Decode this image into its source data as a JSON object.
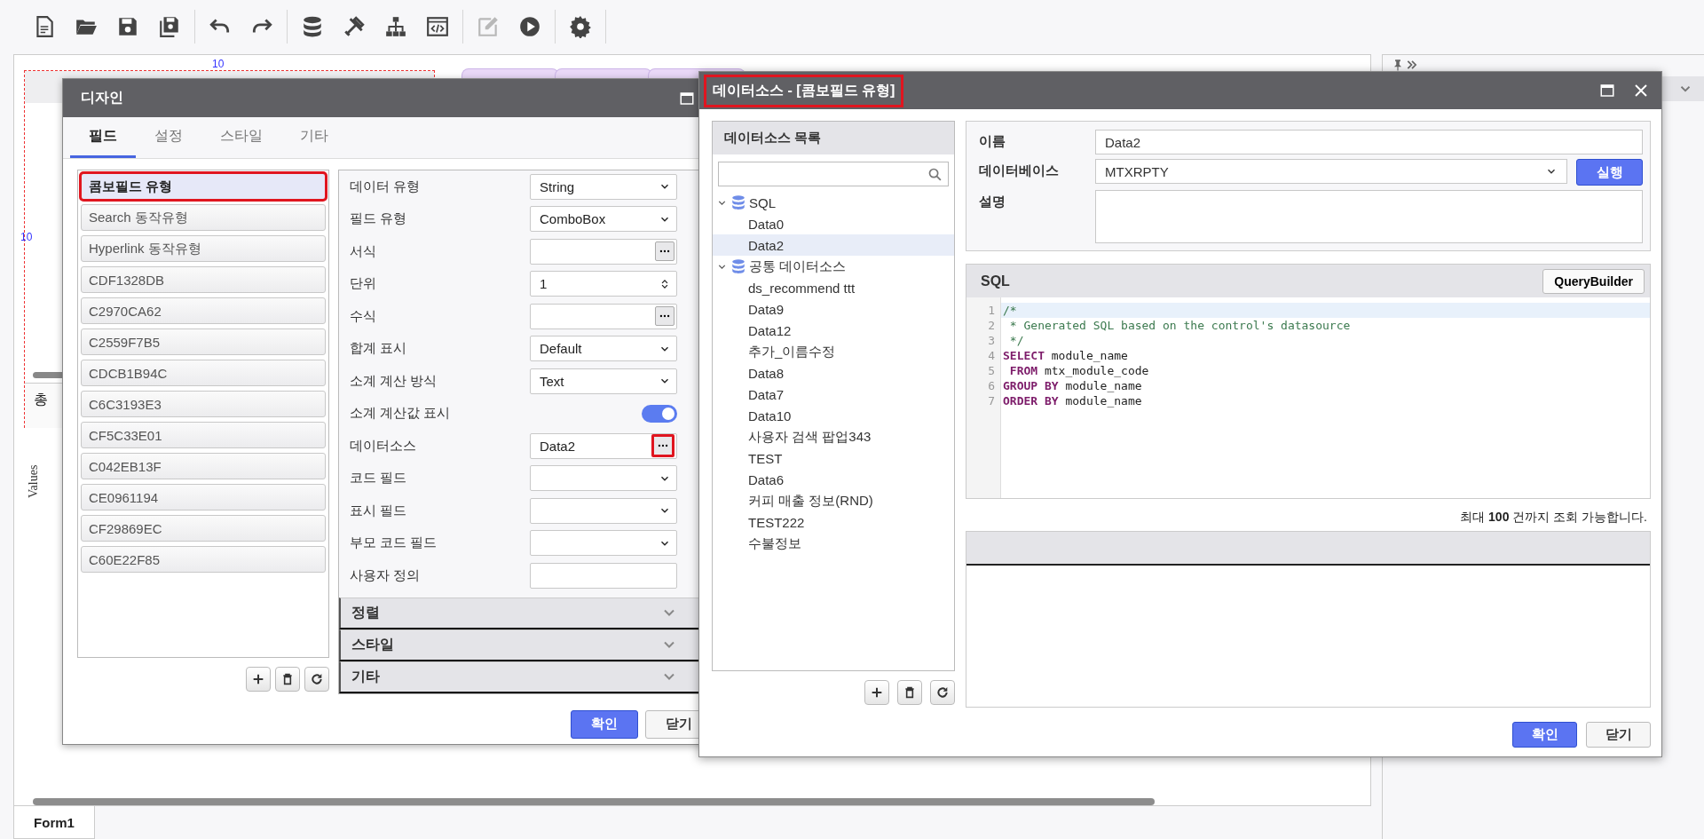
{
  "toolbar": {
    "groups": [
      [
        {
          "disabled": false
        },
        {
          "disabled": false
        },
        {
          "disabled": false
        },
        {
          "disabled": false
        }
      ],
      [
        {
          "disabled": false
        },
        {
          "disabled": false
        }
      ],
      [
        {
          "disabled": false
        },
        {
          "disabled": false
        },
        {
          "disabled": false
        },
        {
          "disabled": false
        }
      ],
      [
        {
          "disabled": true
        },
        {
          "disabled": false
        }
      ],
      [
        {
          "disabled": false
        }
      ]
    ]
  },
  "canvas": {
    "ruler_labels": [
      "10",
      "10"
    ],
    "summary_label": "총",
    "axis_label": "Values"
  },
  "form_tabs": [
    {
      "label": "Form1",
      "selected": true
    }
  ],
  "design_dialog": {
    "title": "디자인",
    "tabs": [
      {
        "label": "필드",
        "selected": true
      },
      {
        "label": "설정",
        "selected": false
      },
      {
        "label": "스타일",
        "selected": false
      },
      {
        "label": "기타",
        "selected": false
      }
    ],
    "fields": [
      {
        "label": "콤보필드 유형",
        "selected": true,
        "highlighted": true
      },
      {
        "label": "Search 동작유형",
        "selected": false,
        "highlighted": false
      },
      {
        "label": "Hyperlink 동작유형",
        "selected": false,
        "highlighted": false
      },
      {
        "label": "CDF1328DB",
        "selected": false,
        "highlighted": false
      },
      {
        "label": "C2970CA62",
        "selected": false,
        "highlighted": false
      },
      {
        "label": "C2559F7B5",
        "selected": false,
        "highlighted": false
      },
      {
        "label": "CDCB1B94C",
        "selected": false,
        "highlighted": false
      },
      {
        "label": "C6C3193E3",
        "selected": false,
        "highlighted": false
      },
      {
        "label": "CF5C33E01",
        "selected": false,
        "highlighted": false
      },
      {
        "label": "C042EB13F",
        "selected": false,
        "highlighted": false
      },
      {
        "label": "CE0961194",
        "selected": false,
        "highlighted": false
      },
      {
        "label": "CF29869EC",
        "selected": false,
        "highlighted": false
      },
      {
        "label": "C60E22F85",
        "selected": false,
        "highlighted": false
      }
    ],
    "properties": [
      {
        "label": "데이터 유형",
        "kind": "select",
        "value": "String"
      },
      {
        "label": "필드 유형",
        "kind": "select",
        "value": "ComboBox"
      },
      {
        "label": "서식",
        "kind": "picker",
        "highlighted": false
      },
      {
        "label": "단위",
        "kind": "spinner",
        "value": "1"
      },
      {
        "label": "수식",
        "kind": "picker",
        "highlighted": false
      },
      {
        "label": "합계 표시",
        "kind": "select",
        "value": "Default"
      },
      {
        "label": "소계 계산 방식",
        "kind": "select",
        "value": "Text"
      },
      {
        "label": "소계 계산값 표시",
        "kind": "toggle",
        "on": true
      },
      {
        "label": "데이터소스",
        "kind": "picker",
        "value": "Data2",
        "highlighted": true
      },
      {
        "label": "코드 필드",
        "kind": "select"
      },
      {
        "label": "표시 필드",
        "kind": "select"
      },
      {
        "label": "부모 코드 필드",
        "kind": "select"
      },
      {
        "label": "사용자 정의",
        "kind": "text"
      }
    ],
    "sections": [
      "정렬",
      "스타일",
      "기타"
    ],
    "buttons": [
      "확인",
      "닫기"
    ]
  },
  "datasource_dialog": {
    "title": "데이터소스 - [콤보필드 유형]",
    "title_highlighted": true,
    "list_title": "데이터소스 목록",
    "tree": [
      {
        "label": "SQL",
        "expanded": true,
        "selected": false,
        "children": [
          {
            "label": "Data0",
            "selected": false
          },
          {
            "label": "Data2",
            "selected": true
          }
        ]
      },
      {
        "label": "공통 데이터소스",
        "expanded": true,
        "selected": false,
        "children": [
          {
            "label": "ds_recommend ttt",
            "selected": false
          },
          {
            "label": "Data9",
            "selected": false
          },
          {
            "label": "Data12",
            "selected": false
          },
          {
            "label": "추가_이름수정",
            "selected": false
          },
          {
            "label": "Data8",
            "selected": false
          },
          {
            "label": "Data7",
            "selected": false
          },
          {
            "label": "Data10",
            "selected": false
          },
          {
            "label": "사용자 검색 팝업343",
            "selected": false
          },
          {
            "label": "TEST",
            "selected": false
          },
          {
            "label": "Data6",
            "selected": false
          },
          {
            "label": "커피 매출 정보(RND)",
            "selected": false
          },
          {
            "label": "TEST222",
            "selected": false
          },
          {
            "label": "수불정보",
            "selected": false
          }
        ]
      }
    ],
    "name_label": "이름",
    "name_value": "Data2",
    "database_label": "데이터베이스",
    "database_value": "MTXRPTY",
    "run_button": "실행",
    "description_label": "설명",
    "sql_title": "SQL",
    "query_builder_button": "QueryBuilder",
    "code_lines": [
      {
        "number": "1",
        "current": true,
        "tokens": [
          {
            "kind": "comment",
            "text": "/*"
          }
        ]
      },
      {
        "number": "2",
        "current": false,
        "tokens": [
          {
            "kind": "comment",
            "text": " * Generated SQL based on the control's datasource"
          }
        ]
      },
      {
        "number": "3",
        "current": false,
        "tokens": [
          {
            "kind": "comment",
            "text": " */"
          }
        ]
      },
      {
        "number": "4",
        "current": false,
        "tokens": [
          {
            "kind": "keyword",
            "text": "SELECT"
          },
          {
            "kind": "plain",
            "text": " module_name"
          }
        ]
      },
      {
        "number": "5",
        "current": false,
        "tokens": [
          {
            "kind": "keyword",
            "text": " FROM"
          },
          {
            "kind": "plain",
            "text": " mtx_module_code"
          }
        ]
      },
      {
        "number": "6",
        "current": false,
        "tokens": [
          {
            "kind": "keyword",
            "text": "GROUP BY"
          },
          {
            "kind": "plain",
            "text": " module_name"
          }
        ]
      },
      {
        "number": "7",
        "current": false,
        "tokens": [
          {
            "kind": "keyword",
            "text": "ORDER BY"
          },
          {
            "kind": "plain",
            "text": " module_name"
          }
        ]
      }
    ],
    "limit_note": "최대 **100** 건까지 조회 가능합니다.",
    "buttons": [
      "확인",
      "닫기"
    ]
  }
}
